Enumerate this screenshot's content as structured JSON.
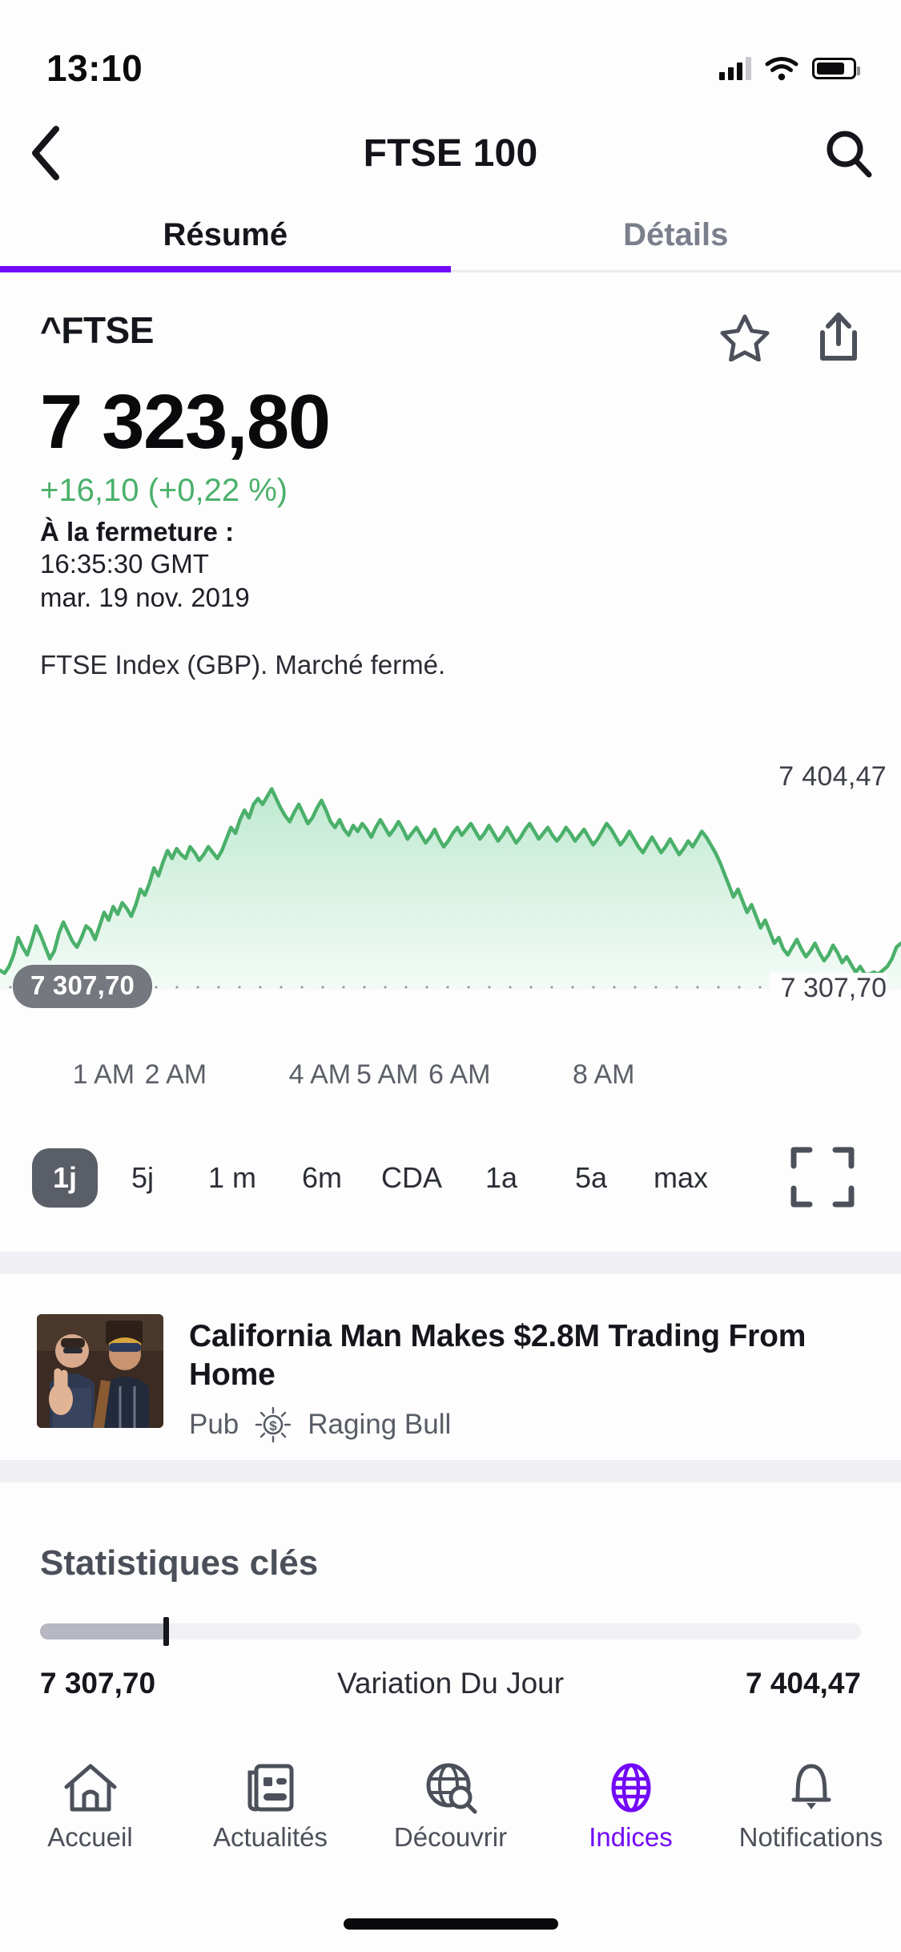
{
  "status_bar": {
    "time": "13:10",
    "signal_icon": "cellular-signal-icon",
    "wifi_icon": "wifi-icon",
    "battery_icon": "battery-icon"
  },
  "nav": {
    "back_icon": "chevron-left-icon",
    "title": "FTSE 100",
    "search_icon": "search-icon"
  },
  "tabs": [
    {
      "label": "Résumé",
      "active": true
    },
    {
      "label": "Détails",
      "active": false
    }
  ],
  "quote": {
    "symbol": "^FTSE",
    "price": "7 323,80",
    "change": "+16,10 (+0,22 %)",
    "change_color": "#4bb06a",
    "close_label": "À la fermeture :",
    "close_time": "16:35:30 GMT",
    "close_date": "mar. 19 nov. 2019",
    "market_note": "FTSE Index (GBP). Marché fermé.",
    "favorite_icon": "star-icon",
    "share_icon": "share-icon"
  },
  "chart_data": {
    "type": "area",
    "title": "",
    "xlabel": "",
    "ylabel": "",
    "high_label": "7 404,47",
    "low_label": "7 307,70",
    "low_badge": "7 307,70",
    "ylim": [
      7300.0,
      7410.0
    ],
    "line_color": "#4bb06a",
    "fill_color": "#cdeedb",
    "grid": false,
    "legend": "none",
    "tick_labels": [
      "1 AM",
      "2 AM",
      "4 AM",
      "5 AM",
      "6 AM",
      "8 AM"
    ],
    "tick_positions_pct": [
      11.5,
      19.5,
      35.5,
      43.0,
      51.0,
      67.0
    ],
    "values": [
      7310,
      7308.5,
      7312,
      7318,
      7327,
      7322,
      7318,
      7325,
      7333,
      7328,
      7322,
      7316,
      7320,
      7329,
      7335,
      7330,
      7325,
      7322,
      7327,
      7333,
      7331,
      7326,
      7333,
      7340,
      7336,
      7343,
      7339,
      7345,
      7342,
      7338,
      7344,
      7352,
      7349,
      7355,
      7363,
      7359,
      7366,
      7372,
      7368,
      7373,
      7370,
      7368,
      7374,
      7371,
      7367,
      7370,
      7374,
      7371,
      7368,
      7372,
      7378,
      7384,
      7381,
      7388,
      7393,
      7389,
      7396,
      7399,
      7396,
      7400,
      7404,
      7399,
      7394,
      7390,
      7387,
      7392,
      7396,
      7391,
      7386,
      7389,
      7394,
      7398,
      7393,
      7387,
      7384,
      7388,
      7383,
      7380,
      7385,
      7382,
      7386,
      7383,
      7379,
      7384,
      7388,
      7384,
      7380,
      7383,
      7387,
      7383,
      7378,
      7381,
      7384,
      7380,
      7376,
      7379,
      7383,
      7378,
      7374,
      7377,
      7381,
      7384,
      7380,
      7383,
      7386,
      7382,
      7378,
      7381,
      7385,
      7381,
      7377,
      7380,
      7384,
      7380,
      7376,
      7379,
      7383,
      7386,
      7382,
      7378,
      7381,
      7384,
      7380,
      7377,
      7380,
      7384,
      7381,
      7377,
      7380,
      7383,
      7379,
      7375,
      7378,
      7382,
      7386,
      7383,
      7379,
      7375,
      7378,
      7382,
      7378,
      7374,
      7371,
      7375,
      7379,
      7375,
      7371,
      7374,
      7378,
      7374,
      7370,
      7373,
      7377,
      7374,
      7378,
      7382,
      7379,
      7375,
      7371,
      7366,
      7360,
      7354,
      7348,
      7352,
      7346,
      7340,
      7344,
      7338,
      7332,
      7336,
      7330,
      7324,
      7327,
      7321,
      7318,
      7322,
      7326,
      7321,
      7317,
      7320,
      7324,
      7319,
      7315,
      7318,
      7323,
      7319,
      7314,
      7317,
      7313,
      7309,
      7312,
      7308,
      7308,
      7309,
      7308,
      7310,
      7312,
      7316,
      7322,
      7324
    ]
  },
  "ranges": {
    "options": [
      "1j",
      "5j",
      "1 m",
      "6m",
      "CDA",
      "1a",
      "5a",
      "max"
    ],
    "active": "1j",
    "expand_icon": "fullscreen-icon"
  },
  "ad": {
    "title": "California Man Makes $2.8M Trading From Home",
    "sponsor_label": "Pub",
    "sponsor_icon": "dollar-burst-icon",
    "source": "Raging Bull",
    "thumbnail": "two-men-photo"
  },
  "stats": {
    "title": "Statistiques clés",
    "day_range": {
      "low": "7 307,70",
      "name": "Variation Du Jour",
      "high": "7 404,47",
      "marker_pct": 15
    }
  },
  "bottom_nav": {
    "active_color": "#7209f7",
    "items": [
      {
        "label": "Accueil",
        "icon": "home-icon",
        "active": false
      },
      {
        "label": "Actualités",
        "icon": "news-icon",
        "active": false
      },
      {
        "label": "Découvrir",
        "icon": "globe-search-icon",
        "active": false
      },
      {
        "label": "Indices",
        "icon": "globe-icon",
        "active": true
      },
      {
        "label": "Notifications",
        "icon": "bell-icon",
        "active": false
      }
    ]
  }
}
